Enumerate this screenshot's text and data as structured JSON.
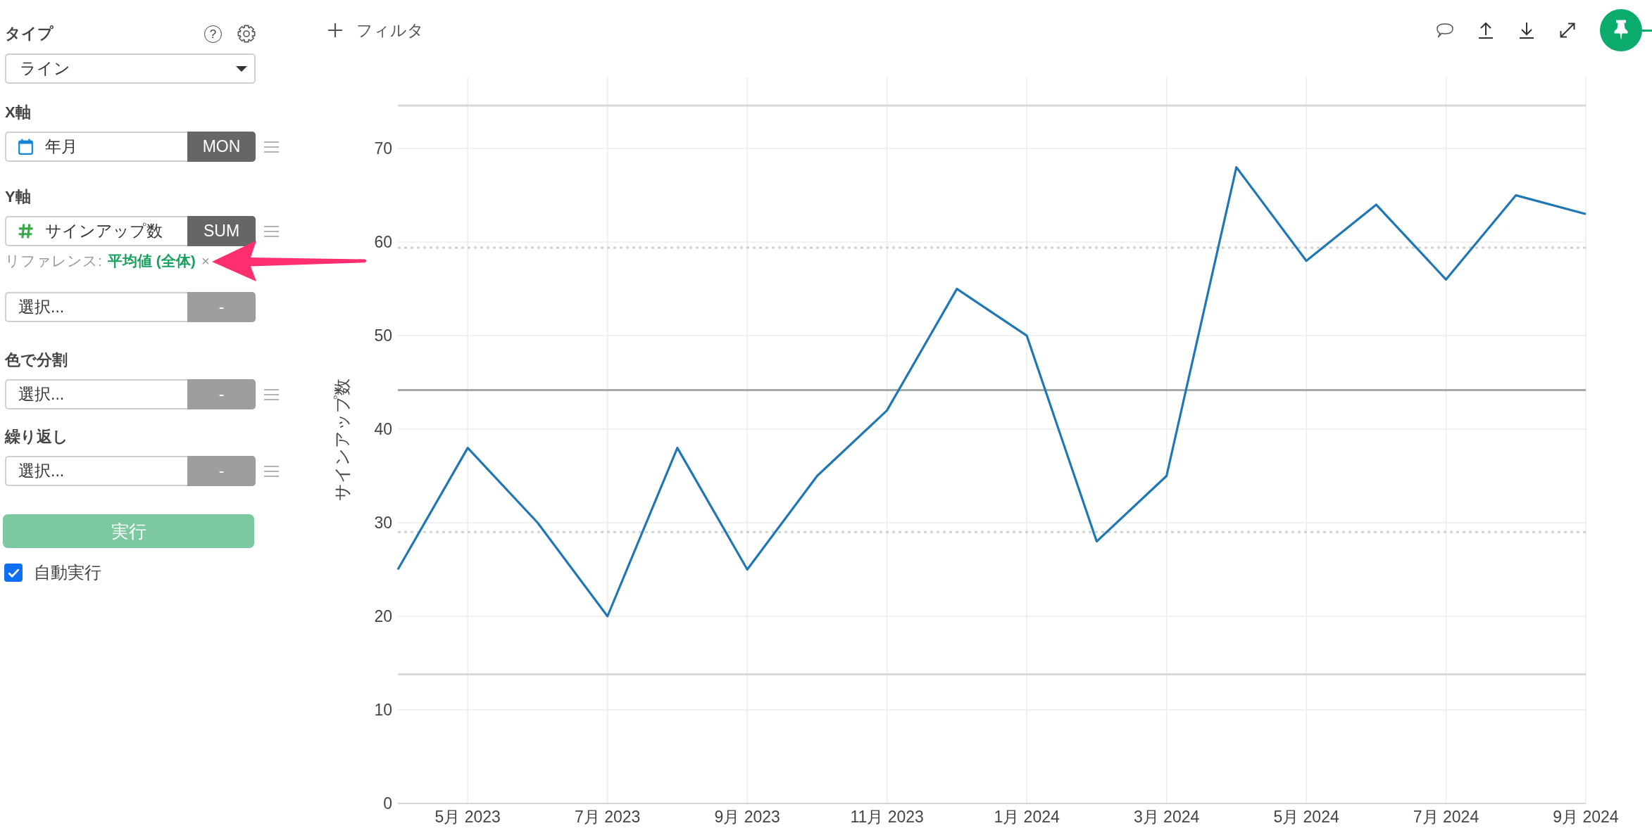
{
  "sidebar": {
    "type": {
      "label": "タイプ",
      "help": "?",
      "value": "ライン"
    },
    "x_axis": {
      "label": "X軸",
      "fields": [
        {
          "kind": "date",
          "value": "年月",
          "aggregation": "MON",
          "drag_handle": true
        }
      ]
    },
    "y_axis": {
      "label": "Y軸",
      "fields": [
        {
          "kind": "number",
          "value": "サインアップ数",
          "aggregation": "SUM",
          "drag_handle": true,
          "reference": {
            "label": "リファレンス:",
            "value": "平均値 (全体)",
            "remove": "×",
            "highlighted": true
          }
        },
        {
          "kind": "empty",
          "placeholder": "選択...",
          "aggregation": "-",
          "drag_handle": false
        }
      ]
    },
    "color_split": {
      "label": "色で分割",
      "fields": [
        {
          "kind": "empty",
          "placeholder": "選択...",
          "aggregation": "-",
          "drag_handle": true
        }
      ]
    },
    "repeat": {
      "label": "繰り返し",
      "fields": [
        {
          "kind": "empty",
          "placeholder": "選択...",
          "aggregation": "-",
          "drag_handle": true
        }
      ]
    },
    "run_button": "実行",
    "auto_run": {
      "label": "自動実行",
      "checked": true
    }
  },
  "toolbar": {
    "filter": "フィルタ"
  },
  "chart": {
    "chart_data": {
      "type": "line",
      "ylabel": "サインアップ数",
      "categories": [
        null,
        "5月 2023",
        null,
        "7月 2023",
        null,
        "9月 2023",
        null,
        "11月 2023",
        null,
        "1月 2024",
        null,
        "3月 2024",
        null,
        "5月 2024",
        null,
        "7月 2024",
        null,
        "9月 2024"
      ],
      "series": [
        {
          "color": "#1f77b4",
          "values": [
            25,
            38,
            30,
            20,
            38,
            25,
            35,
            42,
            55,
            50,
            28,
            35,
            68,
            58,
            64,
            56,
            65,
            63
          ]
        }
      ],
      "ylim": [
        0,
        77.6
      ],
      "yticks": [
        0,
        10,
        20,
        30,
        40,
        50,
        60,
        70
      ],
      "grid": true,
      "ref_lines": [
        {
          "axis": "y",
          "value": 74.6,
          "color": "#d8d8d8"
        },
        {
          "axis": "y",
          "value": 59.4,
          "color": "#d2d2d2"
        },
        {
          "axis": "y",
          "value": 44.17,
          "color": "#a4a9a9"
        },
        {
          "axis": "y",
          "value": 29.0,
          "color": "#d2d2d2"
        },
        {
          "axis": "y",
          "value": 13.8,
          "color": "#d8d8d8"
        }
      ]
    }
  }
}
